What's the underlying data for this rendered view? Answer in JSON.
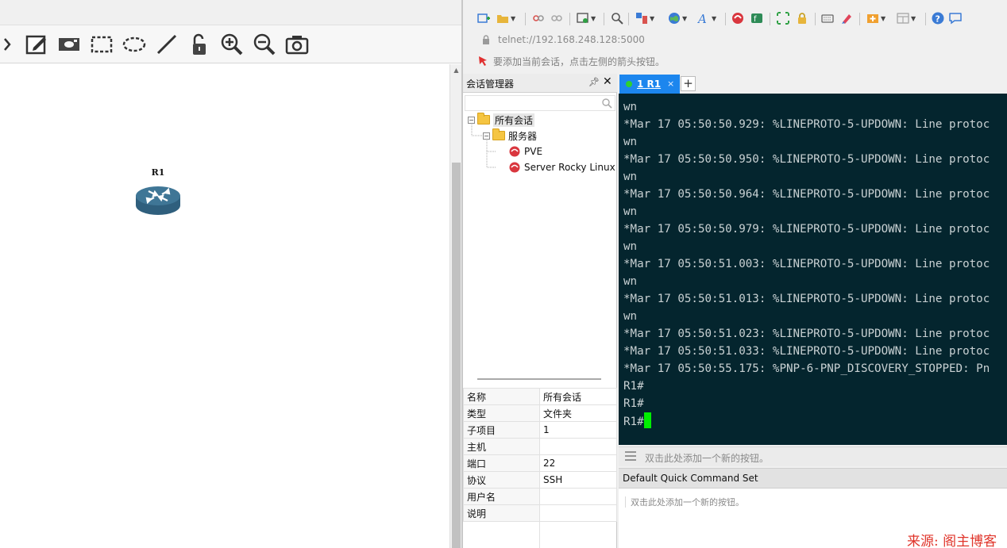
{
  "left_app": {
    "toolbar_icons": [
      "note-icon",
      "picture-icon",
      "rectangle-icon",
      "ellipse-icon",
      "line-icon",
      "lock-icon",
      "zoom-in-icon",
      "zoom-out-icon",
      "screenshot-icon"
    ],
    "node": {
      "label": "R1",
      "icon": "router-icon",
      "color": "#3a6f8f"
    }
  },
  "right_app": {
    "address": "telnet://192.168.248.128:5000",
    "hint": "要添加当前会话，点击左侧的箭头按钮。",
    "session_manager": {
      "title": "会话管理器",
      "pin": "ᵖ",
      "close": "✕",
      "search_placeholder": "",
      "tree": {
        "root": "所有会话",
        "folder": "服务器",
        "sessions": [
          "PVE",
          "Server Rocky Linux"
        ]
      },
      "properties": [
        {
          "key": "名称",
          "value": "所有会话"
        },
        {
          "key": "类型",
          "value": "文件夹"
        },
        {
          "key": "子项目",
          "value": "1"
        },
        {
          "key": "主机",
          "value": ""
        },
        {
          "key": "端口",
          "value": "22"
        },
        {
          "key": "协议",
          "value": "SSH"
        },
        {
          "key": "用户名",
          "value": ""
        },
        {
          "key": "说明",
          "value": ""
        }
      ]
    },
    "tabs": [
      {
        "label": "1 R1",
        "status_color": "#2ed12e",
        "close": "×"
      }
    ],
    "tab_add": "+",
    "terminal": {
      "lines": [
        "wn",
        "*Mar 17 05:50:50.929: %LINEPROTO-5-UPDOWN: Line protoc",
        "wn",
        "*Mar 17 05:50:50.950: %LINEPROTO-5-UPDOWN: Line protoc",
        "wn",
        "*Mar 17 05:50:50.964: %LINEPROTO-5-UPDOWN: Line protoc",
        "wn",
        "*Mar 17 05:50:50.979: %LINEPROTO-5-UPDOWN: Line protoc",
        "wn",
        "*Mar 17 05:50:51.003: %LINEPROTO-5-UPDOWN: Line protoc",
        "wn",
        "*Mar 17 05:50:51.013: %LINEPROTO-5-UPDOWN: Line protoc",
        "wn",
        "*Mar 17 05:50:51.023: %LINEPROTO-5-UPDOWN: Line protoc",
        "*Mar 17 05:50:51.033: %LINEPROTO-5-UPDOWN: Line protoc",
        "*Mar 17 05:50:55.175: %PNP-6-PNP_DISCOVERY_STOPPED: Pn",
        "R1#",
        "R1#",
        "R1#"
      ],
      "background": "#04252e",
      "cursor_color": "#00ee00"
    },
    "quick_bar": {
      "hint": "双击此处添加一个新的按钮。"
    },
    "quick_command_set": {
      "title": "Default Quick Command Set",
      "hint": "双击此处添加一个新的按钮。"
    }
  },
  "watermark": "来源: 阁主博客"
}
